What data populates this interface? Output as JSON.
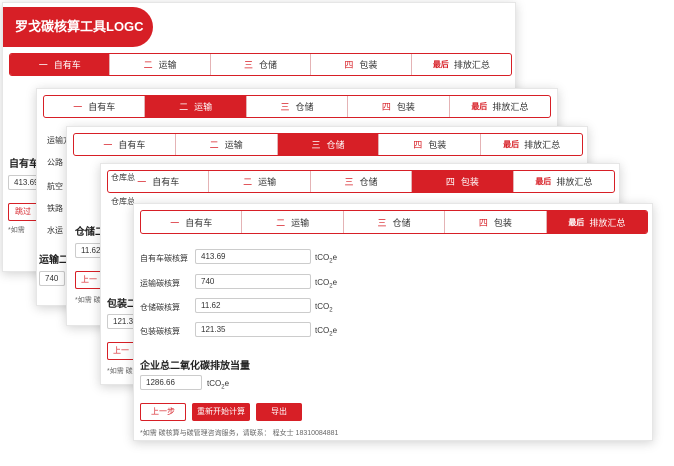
{
  "app": {
    "title": "罗戈碳核算工具LOGC"
  },
  "tabs": [
    {
      "num": "一",
      "label": "自有车"
    },
    {
      "num": "二",
      "label": "运输"
    },
    {
      "num": "三",
      "label": "仓储"
    },
    {
      "num": "四",
      "label": "包装"
    },
    {
      "num": "最后",
      "label": "排放汇总"
    }
  ],
  "card1": {
    "field_label": "自有车",
    "field_value": "413.69",
    "button_label": "跳过",
    "note": "*如需"
  },
  "card2": {
    "labels": [
      "运输方",
      "公路",
      "航空",
      "铁路",
      "水运"
    ],
    "section_title": "运输二",
    "field_value": "740"
  },
  "card3": {
    "section_title": "仓储二",
    "field_value": "11.62",
    "button_label": "上一",
    "note": "*如需 碳"
  },
  "card4": {
    "labels": [
      "仓库总",
      "仓库总"
    ],
    "section_title": "包装二",
    "field_value": "121.35",
    "button_label": "上一",
    "note": "*如需 碳"
  },
  "summary": {
    "rows": [
      {
        "label": "自有车碳核算",
        "value": "413.69",
        "unit": "tCO2e"
      },
      {
        "label": "运输碳核算",
        "value": "740",
        "unit": "tCO2e"
      },
      {
        "label": "仓储碳核算",
        "value": "11.62",
        "unit": "tCO2"
      },
      {
        "label": "包装碳核算",
        "value": "121.35",
        "unit": "tCO2e"
      }
    ],
    "total_title": "企业总二氧化碳排放当量",
    "total_value": "1286.66",
    "total_unit": "tCO2e",
    "buttons": {
      "prev": "上一步",
      "restart": "重新开始计算",
      "export": "导出"
    },
    "footer": "*如需 碳核算与碳管理咨询服务，请联系： 程女士 18310084881"
  },
  "colors": {
    "accent": "#d71f26"
  }
}
